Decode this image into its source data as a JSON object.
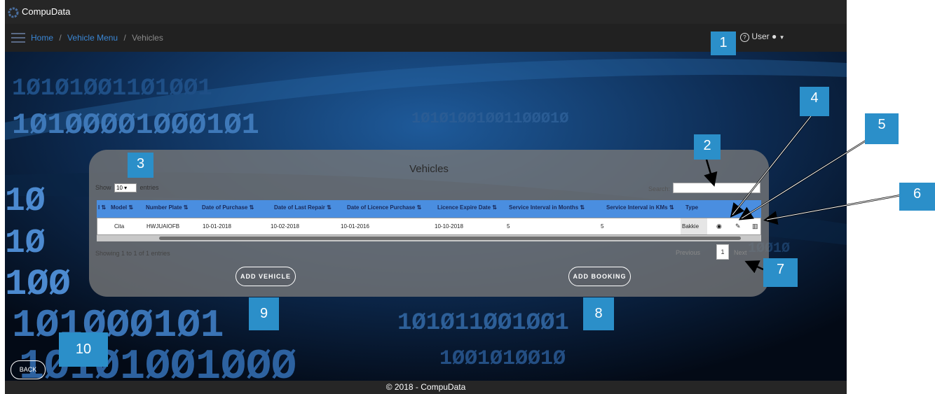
{
  "app": {
    "brand": "CompuData"
  },
  "nav": {
    "breadcrumb": [
      "Home",
      "Vehicle Menu",
      "Vehicles"
    ],
    "separator": "/",
    "help_icon": "question-circle-icon",
    "user_label": "User",
    "user_icon": "user-icon",
    "caret_icon": "caret-down-icon"
  },
  "panel": {
    "title": "Vehicles",
    "show_label": "Show",
    "entries_value": "10",
    "entries_label": "entries",
    "search_label": "Search:",
    "search_value": "",
    "columns": [
      "I",
      "Model",
      "Number Plate",
      "Date of Purchase",
      "Date of Last Repair",
      "Date of Licence Purchase",
      "Licence Expire Date",
      "Service Interval in Months",
      "Service Interval in KMs",
      "Type"
    ],
    "rows": [
      {
        "model": "Cita",
        "number_plate": "HWJUAIOFB",
        "date_of_purchase": "10-01-2018",
        "date_of_last_repair": "10-02-2018",
        "date_of_licence_purchase": "10-01-2016",
        "licence_expire_date": "10-10-2018",
        "service_interval_months": "5",
        "service_interval_kms": "5",
        "type": "Bakkie"
      }
    ],
    "row_actions": [
      "view-icon",
      "edit-icon",
      "delete-icon"
    ],
    "info_text": "Showing 1 to 1 of 1 entries",
    "pagination": {
      "previous": "Previous",
      "current": "1",
      "next": "Next"
    },
    "add_vehicle_label": "ADD VEHICLE",
    "add_booking_label": "ADD BOOKING"
  },
  "back_label": "BACK",
  "footer": "© 2018 - CompuData",
  "callouts": [
    "1",
    "2",
    "3",
    "4",
    "5",
    "6",
    "7",
    "8",
    "9",
    "10"
  ],
  "colors": {
    "callout": "#2b8fc9",
    "table_header": "#4a8ee0",
    "link": "#3a86d4",
    "bar": "#262626"
  }
}
